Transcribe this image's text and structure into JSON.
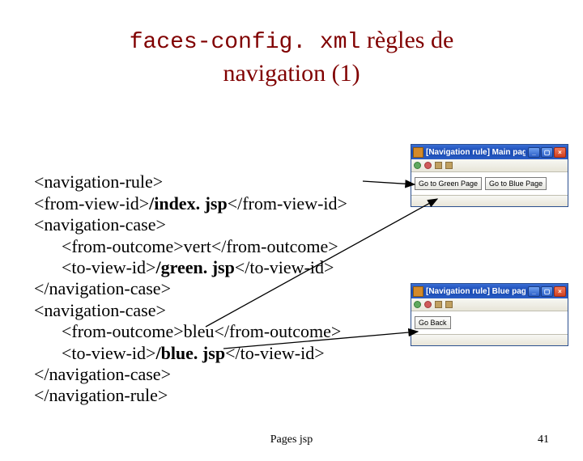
{
  "title": {
    "mono": "faces-config. xml",
    "rest1": " règles de",
    "rest2": "navigation (1)"
  },
  "code": {
    "l1": "<navigation-rule>",
    "l2a": "<from-view-id>",
    "l2b": "/index. jsp",
    "l2c": "</from-view-id>",
    "l3": "<navigation-case>",
    "l4": "<from-outcome>vert</from-outcome>",
    "l5a": "<to-view-id>",
    "l5b": "/green. jsp",
    "l5c": "</to-view-id>",
    "l6": "</navigation-case>",
    "l7": "<navigation-case>",
    "l8": "<from-outcome>bleu</from-outcome>",
    "l9a": "<to-view-id>",
    "l9b": "/blue. jsp",
    "l9c": "</to-view-id>",
    "l10": "</navigation-case>",
    "l11": "</navigation-rule>"
  },
  "windows": {
    "main": {
      "title": "[Navigation rule] Main page…",
      "btnGreen": "Go to Green Page",
      "btnBlue": "Go to Blue Page"
    },
    "blue": {
      "title": "[Navigation rule] Blue page …",
      "btnBack": "Go Back"
    }
  },
  "footer": {
    "center": "Pages jsp",
    "pageNum": "41"
  }
}
